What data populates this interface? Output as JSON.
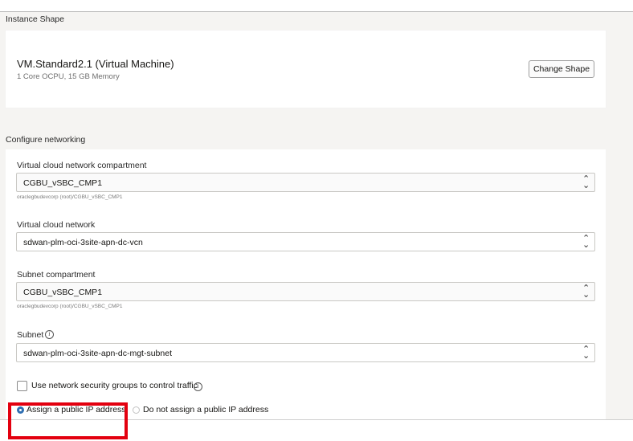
{
  "instance_shape": {
    "section_title": "Instance Shape",
    "shape_name": "VM.Standard2.1 (Virtual Machine)",
    "shape_details": "1 Core OCPU, 15 GB Memory",
    "change_button": "Change Shape"
  },
  "networking": {
    "section_title": "Configure networking",
    "vcn_compartment": {
      "label": "Virtual cloud network compartment",
      "value": "CGBU_vSBC_CMP1",
      "help": "oraclegbudevcorp (root)/CGBU_vSBC_CMP1"
    },
    "vcn": {
      "label": "Virtual cloud network",
      "value": "sdwan-plm-oci-3site-apn-dc-vcn"
    },
    "subnet_compartment": {
      "label": "Subnet compartment",
      "value": "CGBU_vSBC_CMP1",
      "help": "oraclegbudevcorp (root)/CGBU_vSBC_CMP1"
    },
    "subnet": {
      "label": "Subnet",
      "value": "sdwan-plm-oci-3site-apn-dc-mgt-subnet"
    },
    "nsg_checkbox_label": "Use network security groups to control traffic",
    "public_ip": {
      "assign_label": "Assign a public IP address",
      "no_assign_label": "Do not assign a public IP address",
      "selected": "assign"
    }
  },
  "glyphs": {
    "info": "i",
    "chevron": "⌃⌄"
  },
  "colors": {
    "radio_selected": "#2f6fb2",
    "highlight_box": "#e3000f"
  }
}
